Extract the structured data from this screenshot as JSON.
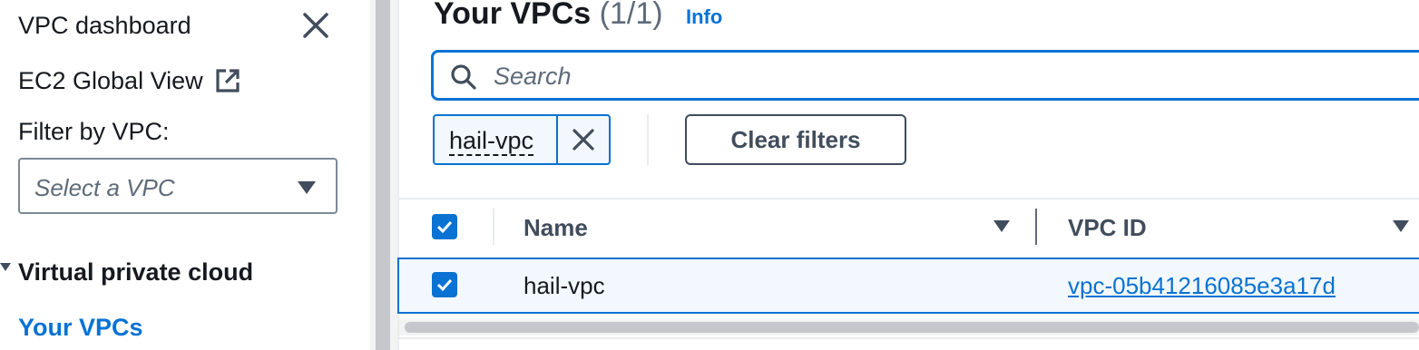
{
  "sidebar": {
    "dashboard": "VPC dashboard",
    "global_view": "EC2 Global View",
    "filter_label": "Filter by VPC:",
    "filter_placeholder": "Select a VPC",
    "section_title": "Virtual private cloud",
    "active_item": "Your VPCs"
  },
  "main": {
    "title": "Your VPCs",
    "count": "(1/1)",
    "info": "Info",
    "search_placeholder": "Search",
    "token_label": "hail-vpc",
    "clear_filters": "Clear filters",
    "columns": {
      "name": "Name",
      "vpc_id": "VPC ID"
    },
    "rows": [
      {
        "name": "hail-vpc",
        "vpc_id": "vpc-05b41216085e3a17d",
        "selected": true
      }
    ]
  },
  "colors": {
    "accent": "#0972d3",
    "text": "#16191f",
    "selected_bg": "#f2f8fd"
  },
  "icons": [
    "close-icon",
    "external-link-icon",
    "dropdown-caret-icon",
    "search-icon",
    "checkmark-icon",
    "sort-icon"
  ]
}
